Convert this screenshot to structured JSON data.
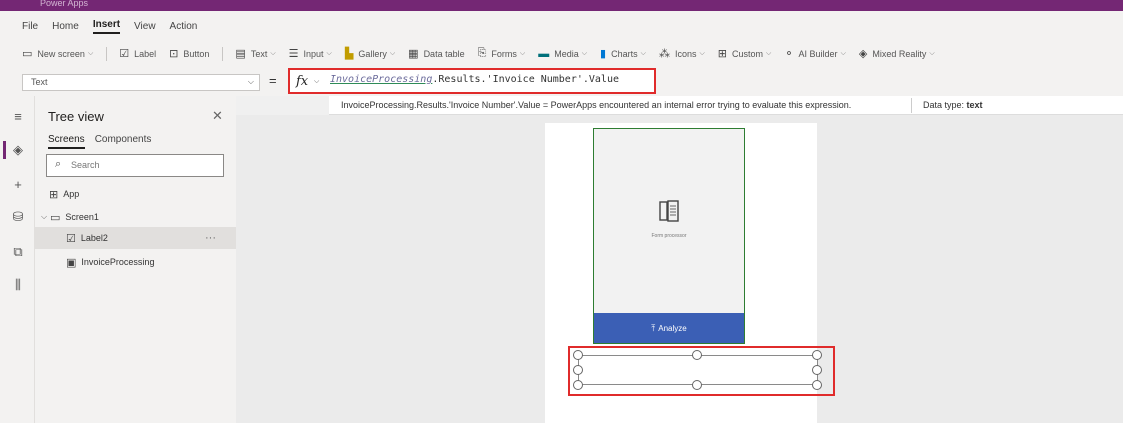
{
  "app": {
    "title": "Power Apps"
  },
  "menu": {
    "tabs": [
      "File",
      "Home",
      "Insert",
      "View",
      "Action"
    ],
    "active": "Insert"
  },
  "ribbon": {
    "new_screen": "New screen",
    "label": "Label",
    "button": "Button",
    "text": "Text",
    "input": "Input",
    "gallery": "Gallery",
    "data_table": "Data table",
    "forms": "Forms",
    "media": "Media",
    "charts": "Charts",
    "icons": "Icons",
    "custom": "Custom",
    "ai_builder": "AI Builder",
    "mixed_reality": "Mixed Reality"
  },
  "formula": {
    "property": "Text",
    "equals": "=",
    "fx": "fx",
    "expression_highlight": "InvoiceProcessing",
    "expression_rest": ".Results.'Invoice Number'.Value"
  },
  "tooltip": {
    "message": "InvoiceProcessing.Results.'Invoice Number'.Value  =  PowerApps encountered an internal error trying to evaluate this expression.",
    "data_type_label": "Data type:",
    "data_type_value": "text"
  },
  "tree": {
    "title": "Tree view",
    "tabs": [
      "Screens",
      "Components"
    ],
    "search_placeholder": "Search",
    "items": [
      {
        "label": "App"
      },
      {
        "label": "Screen1"
      },
      {
        "label": "Label2",
        "more": "···"
      },
      {
        "label": "InvoiceProcessing"
      }
    ]
  },
  "canvas": {
    "form_caption": "Form processor",
    "analyze_label": "Analyze"
  },
  "colors": {
    "brand": "#742774",
    "highlight": "#e02b2b",
    "analyze": "#3b5fb5",
    "form_border": "#2e7d32"
  }
}
